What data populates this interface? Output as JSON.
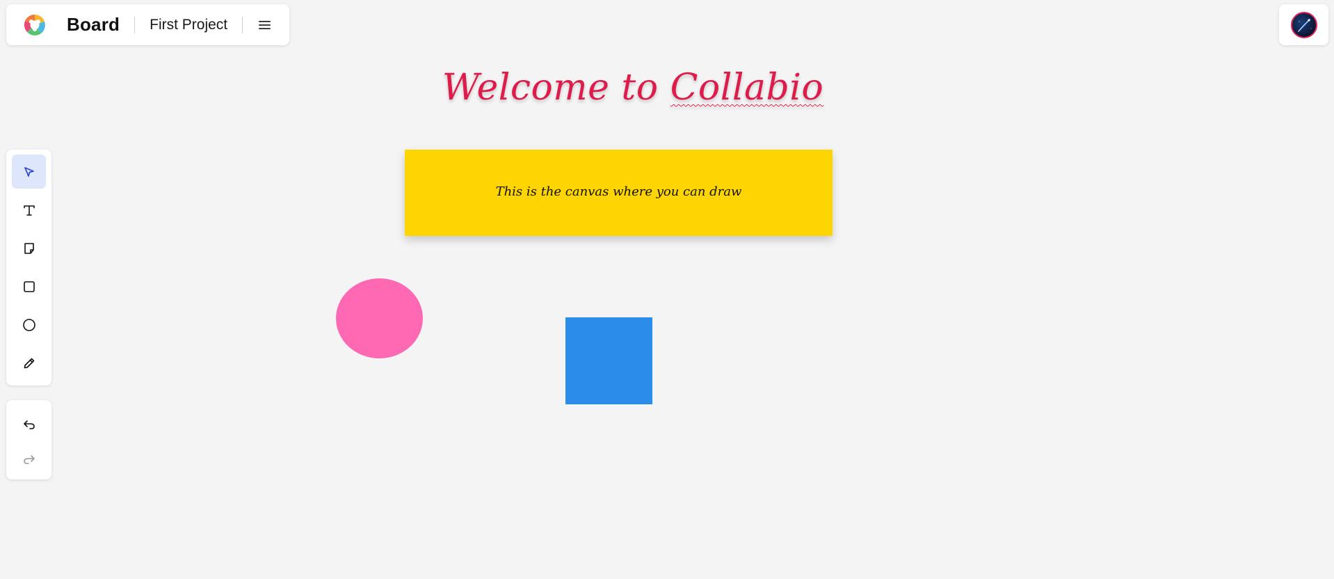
{
  "header": {
    "app_title": "Board",
    "project_name": "First Project",
    "menu_icon": "hamburger-menu-icon",
    "logo_icon": "collabio-logo-icon"
  },
  "user": {
    "avatar_icon": "user-avatar"
  },
  "toolbar": {
    "tools": [
      {
        "name": "select",
        "icon": "cursor-arrow-icon",
        "active": true
      },
      {
        "name": "text",
        "icon": "text-icon",
        "active": false
      },
      {
        "name": "sticky-note",
        "icon": "sticky-note-icon",
        "active": false
      },
      {
        "name": "rectangle",
        "icon": "square-icon",
        "active": false
      },
      {
        "name": "ellipse",
        "icon": "circle-icon",
        "active": false
      },
      {
        "name": "pen",
        "icon": "pencil-icon",
        "active": false
      }
    ],
    "history": [
      {
        "name": "undo",
        "icon": "undo-icon",
        "enabled": true
      },
      {
        "name": "redo",
        "icon": "redo-icon",
        "enabled": false
      }
    ]
  },
  "canvas": {
    "heading_prefix": "Welcome to ",
    "heading_brand": "Collabio",
    "heading_color": "#dd1c4b",
    "sticky_note": {
      "text": "This is the canvas where you can draw",
      "color": "#ffd500"
    },
    "ellipse": {
      "color": "#ff69b4"
    },
    "rectangle": {
      "color": "#2b8cea"
    }
  },
  "colors": {
    "background": "#f4f4f4",
    "active_tool_bg": "#dde6fb",
    "accent": "#2f46c8"
  }
}
